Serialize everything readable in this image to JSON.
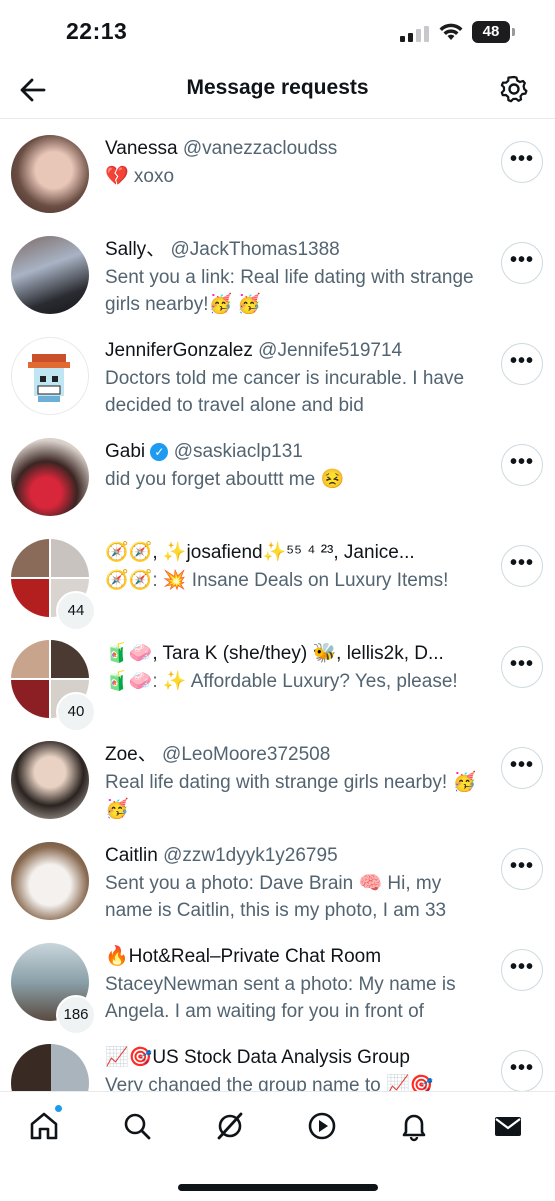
{
  "status_bar": {
    "time": "22:13",
    "battery": "48"
  },
  "header": {
    "title": "Message requests"
  },
  "colors": {
    "accent": "#1d9bf0",
    "secondary_text": "#536471",
    "border": "#e7e9ea"
  },
  "requests": [
    {
      "name": "Vanessa",
      "handle": "@vanezzacloudss",
      "preview": "💔 xoxo"
    },
    {
      "name": "Sally、",
      "handle": " @JackThomas1388",
      "preview": "Sent you a link: Real life dating with strange girls nearby!🥳 🥳"
    },
    {
      "name": "JenniferGonzalez",
      "handle": "@Jennife519714",
      "preview": "Doctors told me cancer is incurable. I have decided to travel alone and bid"
    },
    {
      "name": "Gabi",
      "handle": "@saskiaclp131",
      "preview": "did you forget abouttt me 😣"
    },
    {
      "name": "🧭🧭, ✨josafiend✨⁵⁵ ⁴ ²³, Janice...",
      "handle": "",
      "preview": "🧭🧭: 💥 Insane  Deals      on Luxury Items!",
      "count": "44"
    },
    {
      "name": "🧃🧼, Tara K (she/they) 🐝, lellis2k, D...",
      "handle": "",
      "preview": "🧃🧼: ✨ Affordable  Luxury? Yes, please!",
      "count": "40"
    },
    {
      "name": "Zoe、",
      "handle": " @LeoMoore372508",
      "preview": "Real life dating with strange girls nearby! 🥳🥳"
    },
    {
      "name": "Caitlin",
      "handle": "@zzw1dyyk1y26795",
      "preview": "Sent you a photo: Dave Brain 🧠 Hi, my name is Caitlin, this is my photo, I am 33"
    },
    {
      "name": "🔥Hot&Real–Private Chat Room",
      "handle": "",
      "preview": "StaceyNewman sent a photo: My name is Angela. I am waiting for you in front of",
      "count": "186"
    },
    {
      "name": "📈🎯US Stock Data Analysis Group",
      "handle": "",
      "preview": "Very changed the group name to 📈🎯"
    }
  ],
  "more_label": "•••",
  "nav": {
    "items": [
      "home-icon",
      "search-icon",
      "grok-icon",
      "video-icon",
      "notifications-icon",
      "messages-icon"
    ]
  }
}
